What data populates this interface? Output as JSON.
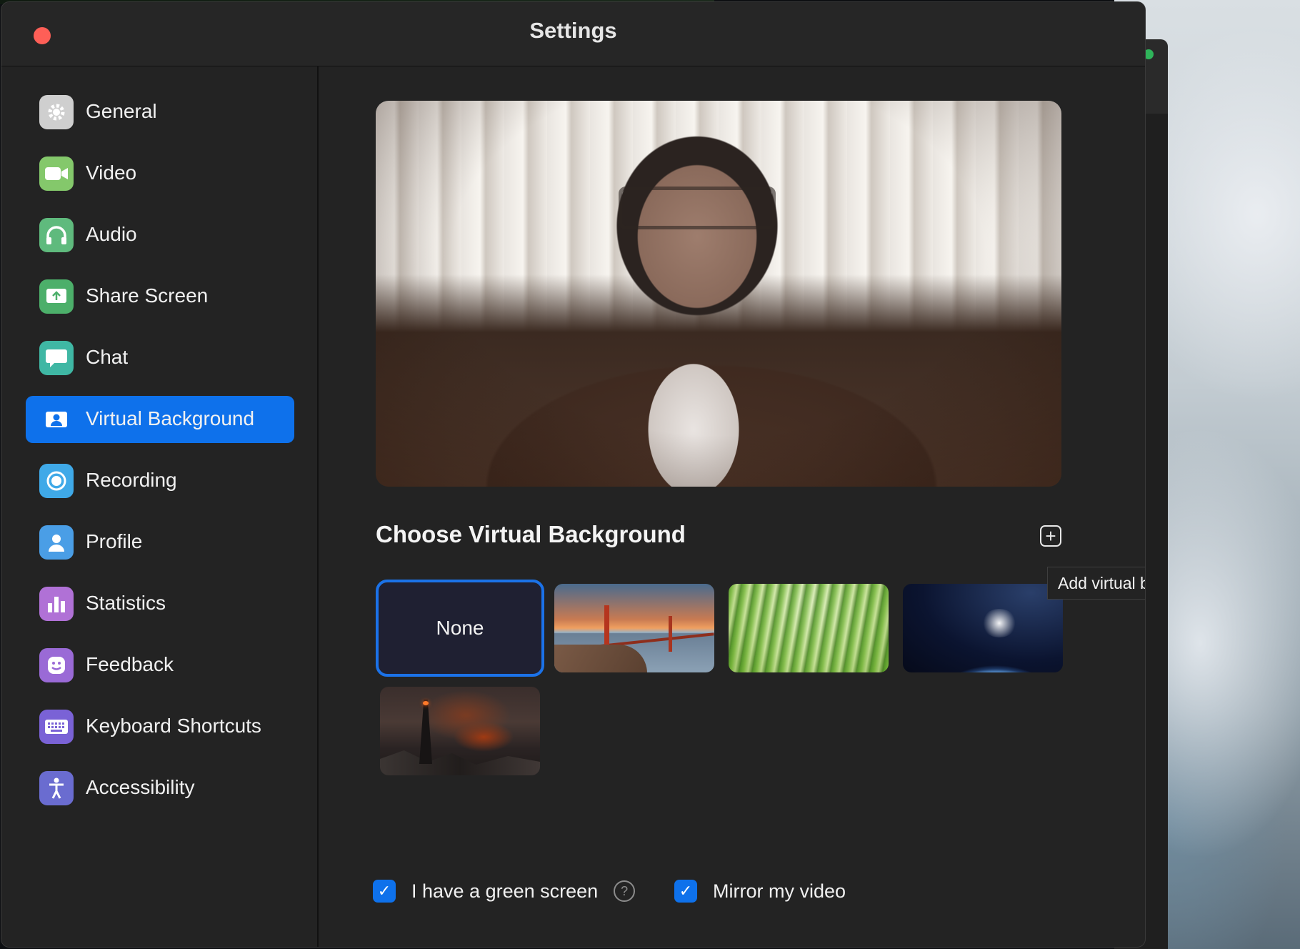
{
  "window": {
    "title": "Settings"
  },
  "sidebar": {
    "items": [
      {
        "label": "General",
        "icon": "gear-icon",
        "color": "#d0d0d0"
      },
      {
        "label": "Video",
        "icon": "video-camera-icon",
        "color": "#7cc46a"
      },
      {
        "label": "Audio",
        "icon": "headphones-icon",
        "color": "#5fba7d"
      },
      {
        "label": "Share Screen",
        "icon": "share-screen-icon",
        "color": "#4caf6a"
      },
      {
        "label": "Chat",
        "icon": "chat-bubble-icon",
        "color": "#3fb7a4"
      },
      {
        "label": "Virtual Background",
        "icon": "person-card-icon",
        "color": "#0e71eb",
        "active": true
      },
      {
        "label": "Recording",
        "icon": "record-icon",
        "color": "#3fa9e8"
      },
      {
        "label": "Profile",
        "icon": "person-icon",
        "color": "#4a9ee6"
      },
      {
        "label": "Statistics",
        "icon": "bar-chart-icon",
        "color": "#b071d6"
      },
      {
        "label": "Feedback",
        "icon": "smiley-icon",
        "color": "#9a6ad6"
      },
      {
        "label": "Keyboard Shortcuts",
        "icon": "keyboard-icon",
        "color": "#7a62d6"
      },
      {
        "label": "Accessibility",
        "icon": "accessibility-icon",
        "color": "#6a6cd0"
      }
    ]
  },
  "main": {
    "section_title": "Choose Virtual Background",
    "add_tooltip": "Add virtual background image",
    "backgrounds": [
      {
        "label": "None",
        "selected": true
      },
      {
        "label": "",
        "subject": "golden-gate-bridge"
      },
      {
        "label": "",
        "subject": "grass"
      },
      {
        "label": "",
        "subject": "earth-from-space"
      },
      {
        "label": "",
        "subject": "dark-tower-volcano"
      }
    ],
    "options": [
      {
        "label": "I have a green screen",
        "checked": true,
        "help": "?"
      },
      {
        "label": "Mirror my video",
        "checked": true
      }
    ]
  },
  "colors": {
    "accent": "#0e71eb",
    "background": "#232323",
    "close": "#fe5f57"
  }
}
